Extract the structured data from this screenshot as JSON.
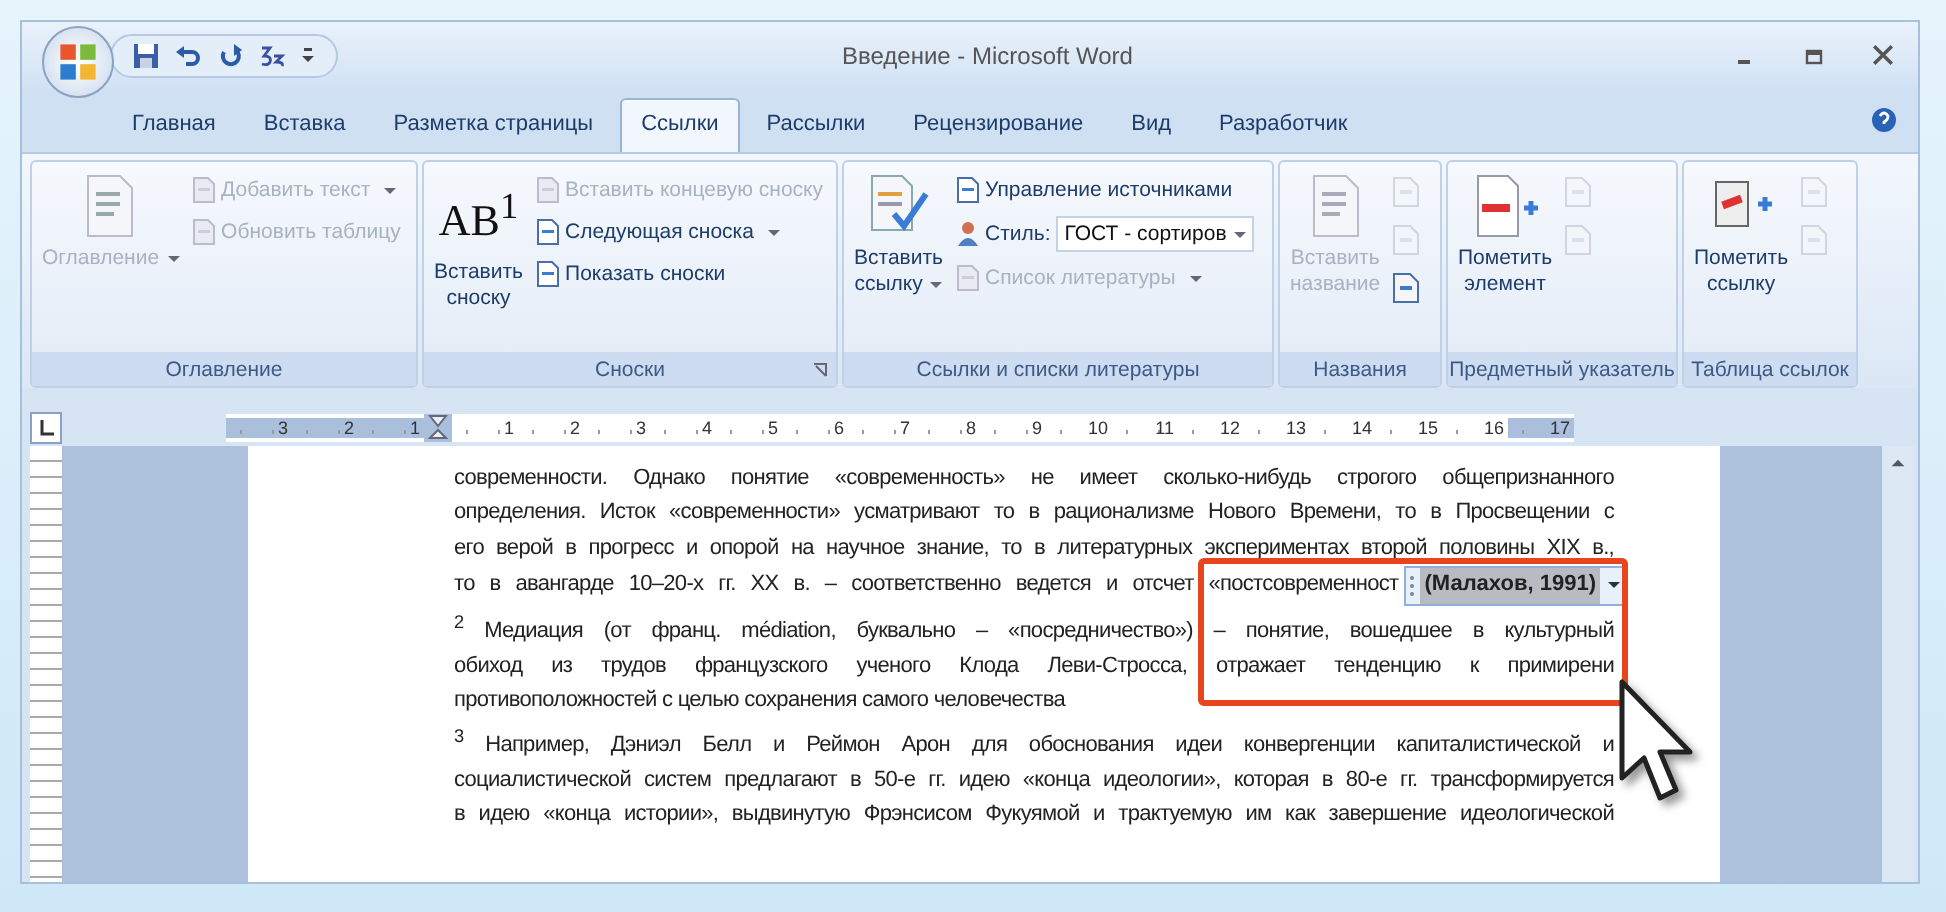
{
  "window": {
    "title": "Введение - Microsoft Word"
  },
  "tabs": [
    {
      "label": "Главная",
      "selected": false
    },
    {
      "label": "Вставка",
      "selected": false
    },
    {
      "label": "Разметка страницы",
      "selected": false
    },
    {
      "label": "Ссылки",
      "selected": true
    },
    {
      "label": "Рассылки",
      "selected": false
    },
    {
      "label": "Рецензирование",
      "selected": false
    },
    {
      "label": "Вид",
      "selected": false
    },
    {
      "label": "Разработчик",
      "selected": false
    }
  ],
  "ribbon": {
    "groups": [
      {
        "label": "Оглавление",
        "large": {
          "kind": "toc",
          "label": "Оглавление",
          "dropdown": true,
          "disabled": true
        },
        "small": [
          {
            "kind": "button",
            "label": "Добавить текст",
            "dropdown": true,
            "disabled": true
          },
          {
            "kind": "button",
            "label": "Обновить таблицу",
            "dropdown": false,
            "disabled": true
          }
        ]
      },
      {
        "label": "Сноски",
        "launcher": true,
        "large": {
          "kind": "footnote",
          "glyph": "AB$^{1}$",
          "label": "Вставить\nсноску",
          "dropdown": false,
          "disabled": false
        },
        "small": [
          {
            "kind": "button",
            "label": "Вставить концевую сноску",
            "dropdown": false,
            "disabled": true
          },
          {
            "kind": "button",
            "label": "Следующая сноска",
            "dropdown": true,
            "disabled": false
          },
          {
            "kind": "button",
            "label": "Показать сноски",
            "dropdown": false,
            "disabled": false
          }
        ]
      },
      {
        "label": "Ссылки и списки литературы",
        "large": {
          "kind": "citation",
          "label": "Вставить\nссылку",
          "dropdown": true,
          "disabled": false
        },
        "small": [
          {
            "kind": "button",
            "label": "Управление источниками",
            "dropdown": false,
            "disabled": false
          },
          {
            "kind": "select",
            "label": "Стиль:",
            "value": "ГОСТ - сортиров",
            "dropdown": true,
            "disabled": false
          },
          {
            "kind": "button",
            "label": "Список литературы",
            "dropdown": true,
            "disabled": true
          }
        ]
      },
      {
        "label": "Названия",
        "large": {
          "kind": "caption",
          "label": "Вставить\nназвание",
          "dropdown": false,
          "disabled": true
        },
        "small": [
          {
            "kind": "icon",
            "disabled": true
          },
          {
            "kind": "icon",
            "disabled": true
          },
          {
            "kind": "icon",
            "disabled": false
          }
        ]
      },
      {
        "label": "Предметный указатель",
        "large": {
          "kind": "mark-entry",
          "label": "Пометить\nэлемент",
          "dropdown": false,
          "disabled": false
        },
        "small": [
          {
            "kind": "icon",
            "disabled": true
          },
          {
            "kind": "icon",
            "disabled": true
          }
        ]
      },
      {
        "label": "Таблица ссылок",
        "large": {
          "kind": "mark-citation",
          "label": "Пометить\nссылку",
          "dropdown": false,
          "disabled": false
        },
        "small": [
          {
            "kind": "icon",
            "disabled": true
          },
          {
            "kind": "icon",
            "disabled": true
          }
        ]
      }
    ]
  },
  "ruler": {
    "left_numbers": [
      "3",
      "2",
      "1"
    ],
    "numbers": [
      "1",
      "2",
      "3",
      "4",
      "5",
      "6",
      "7",
      "8",
      "9",
      "10",
      "11",
      "12",
      "13",
      "14",
      "15",
      "16",
      "17"
    ]
  },
  "document": {
    "lines": [
      {
        "kind": "justified",
        "text": "современности. Однако понятие «современность» не имеет сколько-нибудь строгого общепризнанного"
      },
      {
        "kind": "justified",
        "text": "определения. Исток «современности» усматривают то в рационализме Нового Времени, то в Просвещении с"
      },
      {
        "kind": "justified",
        "text": "его верой в прогресс и опорой на научное знание, то в литературных экспериментах второй половины XIX в.,"
      },
      {
        "kind": "citation",
        "text": "то в авангарде 10–20-х гг. XX в. – соответственно ведется и отсчет «постсовременност",
        "citation": "(Малахов, 1991)"
      },
      {
        "kind": "justified",
        "text": "$^{2}$ Медиация (от франц. médiation, буквально – «посредничество») – понятие, вошедшее в культурный"
      },
      {
        "kind": "justified",
        "text": "обиход из трудов французского ученого Клода Леви-Стросса, отражает тенденцию к примирени"
      },
      {
        "kind": "last",
        "text": "противоположностей с целью сохранения самого человечества"
      },
      {
        "kind": "justified",
        "text": "$^{3}$ Например, Дэниэл Белл и Реймон Арон для обоснования идеи конвергенции капиталистической и"
      },
      {
        "kind": "justified",
        "text": "социалистической систем предлагают в 50-е гг. идею «конца идеологии», которая в 80-е гг. трансформируется"
      },
      {
        "kind": "justified",
        "text": "в идею «конца истории», выдвинутую Фрэнсисом Фукуямой и трактуемую им как завершение идеологической"
      }
    ]
  }
}
